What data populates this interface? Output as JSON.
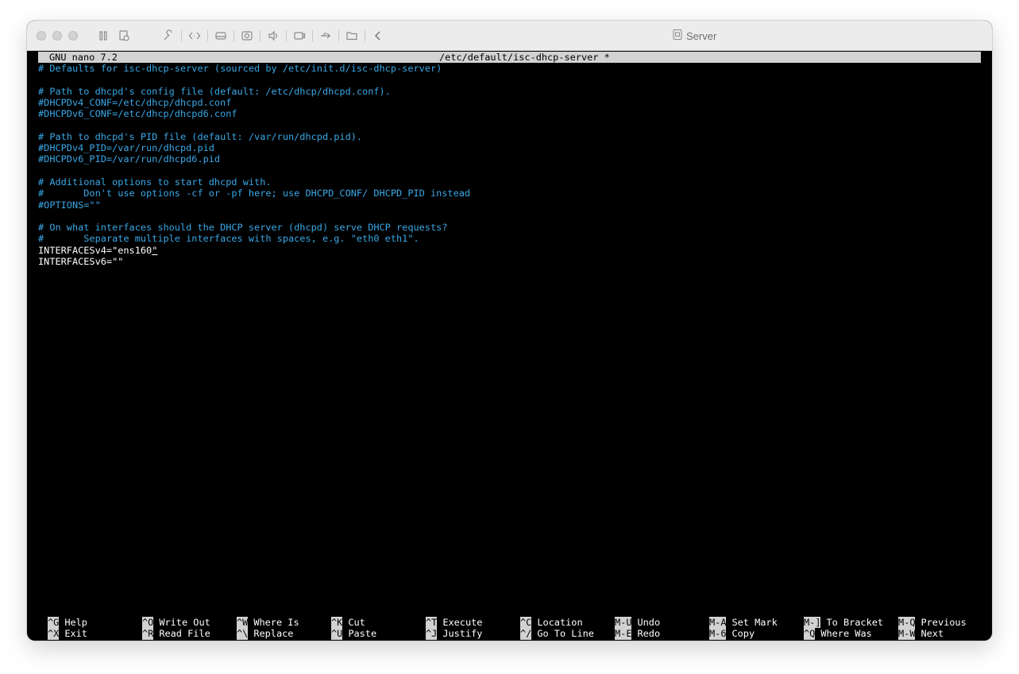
{
  "window": {
    "title": "Server",
    "toolbar_icons": [
      "pause-icon",
      "snapshot-icon",
      "settings-wrench-icon",
      "code-arrows-icon",
      "hard-disk-icon",
      "camera-icon",
      "sound-icon",
      "display-icon",
      "usb-icon",
      "shared-folder-icon",
      "back-chevron-icon"
    ]
  },
  "nano": {
    "version": "GNU nano 7.2",
    "filename": "/etc/default/isc-dhcp-server *"
  },
  "content": {
    "lines": [
      {
        "text": "# Defaults for isc-dhcp-server (sourced by /etc/init.d/isc-dhcp-server)",
        "kind": "comment"
      },
      {
        "text": "",
        "kind": "plain"
      },
      {
        "text": "# Path to dhcpd's config file (default: /etc/dhcp/dhcpd.conf).",
        "kind": "comment"
      },
      {
        "text": "#DHCPDv4_CONF=/etc/dhcp/dhcpd.conf",
        "kind": "comment"
      },
      {
        "text": "#DHCPDv6_CONF=/etc/dhcp/dhcpd6.conf",
        "kind": "comment"
      },
      {
        "text": "",
        "kind": "plain"
      },
      {
        "text": "# Path to dhcpd's PID file (default: /var/run/dhcpd.pid).",
        "kind": "comment"
      },
      {
        "text": "#DHCPDv4_PID=/var/run/dhcpd.pid",
        "kind": "comment"
      },
      {
        "text": "#DHCPDv6_PID=/var/run/dhcpd6.pid",
        "kind": "comment"
      },
      {
        "text": "",
        "kind": "plain"
      },
      {
        "text": "# Additional options to start dhcpd with.",
        "kind": "comment"
      },
      {
        "text": "#       Don't use options -cf or -pf here; use DHCPD_CONF/ DHCPD_PID instead",
        "kind": "comment"
      },
      {
        "text": "#OPTIONS=\"\"",
        "kind": "comment"
      },
      {
        "text": "",
        "kind": "plain"
      },
      {
        "text": "# On what interfaces should the DHCP server (dhcpd) serve DHCP requests?",
        "kind": "comment"
      },
      {
        "text": "#       Separate multiple interfaces with spaces, e.g. \"eth0 eth1\".",
        "kind": "comment"
      },
      {
        "text": "INTERFACESv4=\"ens160",
        "kind": "plain",
        "cursor": "\""
      },
      {
        "text": "INTERFACESv6=\"\"",
        "kind": "plain"
      }
    ]
  },
  "shortcuts": {
    "row1": [
      {
        "key": "^G",
        "label": "Help"
      },
      {
        "key": "^O",
        "label": "Write Out"
      },
      {
        "key": "^W",
        "label": "Where Is"
      },
      {
        "key": "^K",
        "label": "Cut"
      },
      {
        "key": "^T",
        "label": "Execute"
      },
      {
        "key": "^C",
        "label": "Location"
      },
      {
        "key": "M-U",
        "label": "Undo"
      },
      {
        "key": "M-A",
        "label": "Set Mark"
      },
      {
        "key": "M-]",
        "label": "To Bracket"
      },
      {
        "key": "M-Q",
        "label": "Previous"
      }
    ],
    "row2": [
      {
        "key": "^X",
        "label": "Exit"
      },
      {
        "key": "^R",
        "label": "Read File"
      },
      {
        "key": "^\\",
        "label": "Replace"
      },
      {
        "key": "^U",
        "label": "Paste"
      },
      {
        "key": "^J",
        "label": "Justify"
      },
      {
        "key": "^/",
        "label": "Go To Line"
      },
      {
        "key": "M-E",
        "label": "Redo"
      },
      {
        "key": "M-6",
        "label": "Copy"
      },
      {
        "key": "^Q",
        "label": "Where Was"
      },
      {
        "key": "M-W",
        "label": "Next"
      }
    ]
  },
  "colors": {
    "comment": "#3aa7e6",
    "text": "#ffffff",
    "background": "#000000",
    "header_bar": "#d2d2d2"
  }
}
